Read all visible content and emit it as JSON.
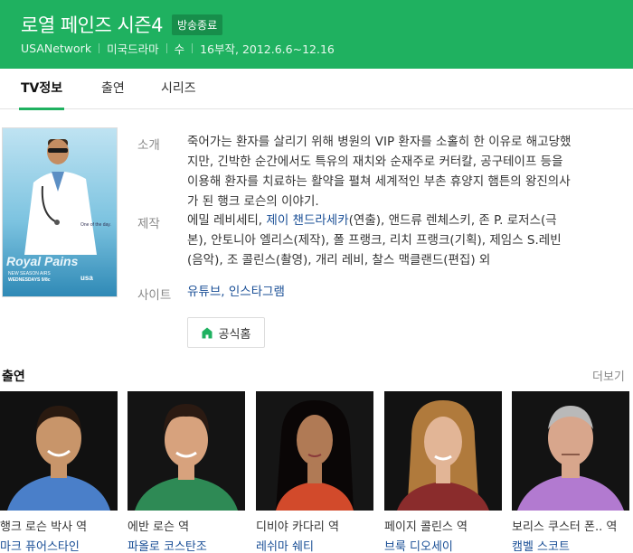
{
  "header": {
    "title": "로열 페인즈 시즌4",
    "badge": "방송종료",
    "network": "USANetwork",
    "genre": "미국드라마",
    "day": "수",
    "episodes": "16부작, 2012.6.6~12.16"
  },
  "tabs": [
    {
      "label": "TV정보",
      "active": true
    },
    {
      "label": "출연",
      "active": false
    },
    {
      "label": "시리즈",
      "active": false
    }
  ],
  "poster": {
    "title": "Royal Pains",
    "tagline": "One of the day.",
    "sub1": "NEW SEASON AIRS",
    "sub2": "WEDNESDAYS 9/8c",
    "logo": "usa"
  },
  "info": {
    "synopsis_label": "소개",
    "synopsis_lines": [
      "죽어가는 환자를 살리기 위해 병원의 VIP 환자를 소홀히 한 이유로 해고당했",
      "지만, 긴박한 순간에서도 특유의 재치와 순재주로 커터칼, 공구테이프 등을",
      "이용해 환자를 치료하는 활약을 펼쳐 세계적인 부촌 휴양지 햄튼의 왕진의사",
      "가 된 행크 로슨의 이야기."
    ],
    "production_label": "제작",
    "production_line1_a": "에밀 레비세티, ",
    "production_line1_link": "제이 챈드라세카",
    "production_line1_b": "(연출), 앤드류 렌체스키, 존 P. 로저스(극",
    "production_line2": "본), 안토니아 엘리스(제작), 폴 프랭크, 리치 프랭크(기획), 제임스 S.레빈",
    "production_line3": "(음악), 조 콜린스(촬영), 개리 레비, 찰스 맥클랜드(편집) 외",
    "site_label": "사이트",
    "site_youtube": "유튜브",
    "site_sep": ", ",
    "site_instagram": "인스타그램",
    "home_button": "공식홈"
  },
  "cast": {
    "title": "출연",
    "more": "더보기",
    "members": [
      {
        "role": "행크 로슨 박사 역",
        "name": "마크 퓨어스타인",
        "shirt": "#4a7fc9",
        "skin": "#c8956a",
        "bg": "#0e0e0e",
        "hair": "#2a1a10"
      },
      {
        "role": "에반 로슨 역",
        "name": "파올로 코스탄조",
        "shirt": "#2e8a55",
        "skin": "#d7a27d",
        "bg": "#141414",
        "hair": "#2b1a12"
      },
      {
        "role": "디비야 카다리 역",
        "name": "레쉬마 쉐티",
        "shirt": "#d24a2b",
        "skin": "#b07a55",
        "bg": "#151515",
        "hair": "#0a0606"
      },
      {
        "role": "페이지 콜린스 역",
        "name": "브룩 디오세이",
        "shirt": "#8a2c2c",
        "skin": "#e2b596",
        "bg": "#121212",
        "hair": "#b07a3c"
      },
      {
        "role": "보리스 쿠스터 폰.. 역",
        "name": "캠벨 스코트",
        "shirt": "#b27ad0",
        "skin": "#d8a68c",
        "bg": "#131313",
        "hair": "#b9b9b9"
      }
    ]
  }
}
